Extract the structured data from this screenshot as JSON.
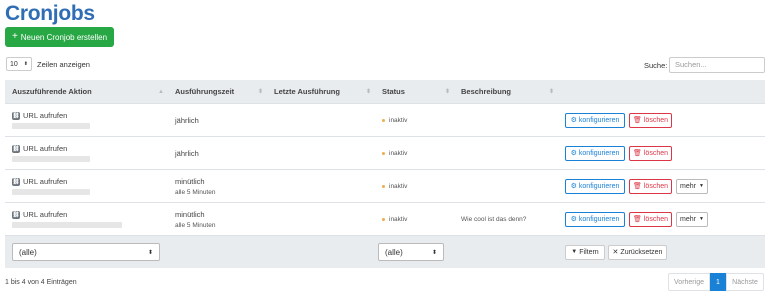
{
  "page": {
    "title": "Cronjobs"
  },
  "toolbar": {
    "create_label": "Neuen Cronjob erstellen"
  },
  "length": {
    "value": "10",
    "label": "Zeilen anzeigen"
  },
  "search": {
    "label": "Suche:",
    "placeholder": "Suchen..."
  },
  "table": {
    "headers": [
      "Auszuführende Aktion",
      "Ausführungszeit",
      "Letzte Ausführung",
      "Status",
      "Beschreibung"
    ],
    "rows": [
      {
        "action": "URL aufrufen",
        "time": "jährlich",
        "time_sub": "",
        "last": "",
        "status": "inaktiv",
        "description": "",
        "has_more": false
      },
      {
        "action": "URL aufrufen",
        "time": "jährlich",
        "time_sub": "",
        "last": "",
        "status": "inaktiv",
        "description": "",
        "has_more": false
      },
      {
        "action": "URL aufrufen",
        "time": "minütlich",
        "time_sub": "alle 5 Minuten",
        "last": "",
        "status": "inaktiv",
        "description": "",
        "has_more": true
      },
      {
        "action": "URL aufrufen",
        "time": "minütlich",
        "time_sub": "alle 5 Minuten",
        "last": "",
        "status": "inaktiv",
        "description": "Wie cool ist das denn?",
        "has_more": true
      }
    ],
    "buttons": {
      "configure": "konfigurieren",
      "delete": "löschen",
      "more": "mehr"
    }
  },
  "filters": {
    "action_value": "(alle)",
    "status_value": "(alle)",
    "filter_label": "Filtern",
    "reset_label": "Zurücksetzen"
  },
  "footer": {
    "info": "1 bis 4 von 4 Einträgen",
    "prev": "Vorherige",
    "current_page": "1",
    "next": "Nächste"
  },
  "colors": {
    "title": "#2f6db5",
    "create": "#28a745",
    "configure": "#1a82d6",
    "delete": "#dc3545",
    "status_dot": "#f0ad4e"
  }
}
